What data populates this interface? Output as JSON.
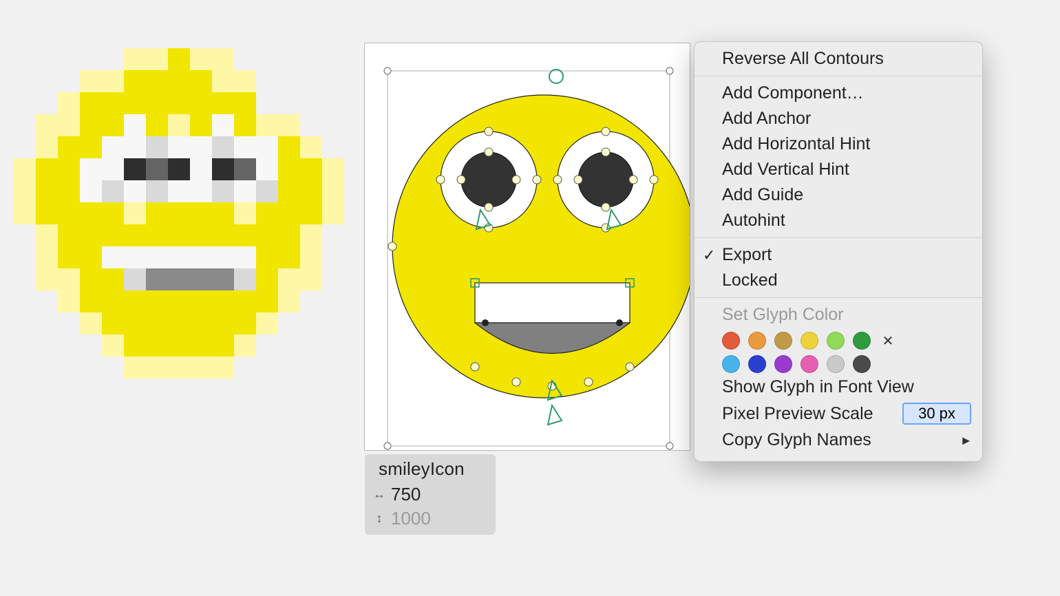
{
  "glyph": {
    "name": "smileyIcon",
    "width": "750",
    "height": "1000"
  },
  "context_menu": {
    "reverse_all": "Reverse All Contours",
    "add_component": "Add Component…",
    "add_anchor": "Add Anchor",
    "add_h_hint": "Add Horizontal Hint",
    "add_v_hint": "Add Vertical Hint",
    "add_guide": "Add Guide",
    "autohint": "Autohint",
    "export": "Export",
    "locked": "Locked",
    "set_glyph_color": "Set Glyph Color",
    "show_in_font_view": "Show Glyph in Font View",
    "pixel_preview_scale_label": "Pixel Preview Scale",
    "pixel_preview_scale_value": "30 px",
    "copy_glyph_names": "Copy Glyph Names"
  },
  "color_swatches": {
    "row1": [
      "#e25b3a",
      "#e89a3c",
      "#bf9a4a",
      "#eed23c",
      "#8fd95b",
      "#2e9c3d"
    ],
    "row2": [
      "#4ab2ea",
      "#2a3fd0",
      "#9a3ad0",
      "#e55fb3",
      "#c9c9c9",
      "#4a4a4a"
    ]
  },
  "pixel_map": [
    "000001121100000",
    "000112222110000",
    "001222222220000",
    "011224212421100",
    "012244544544210",
    "122447674764221",
    "122454544545221",
    "122221222212221",
    "012222222222210",
    "012244444442210",
    "011225888852110",
    "001222222222100",
    "000122222221000",
    "000012222210000",
    "000001111100000"
  ],
  "pixel_color_map": {
    "0": "c0",
    "1": "c1",
    "2": "c3",
    "3": "c2",
    "4": "c4",
    "5": "c5",
    "6": "c6",
    "7": "c7",
    "8": "c8"
  }
}
